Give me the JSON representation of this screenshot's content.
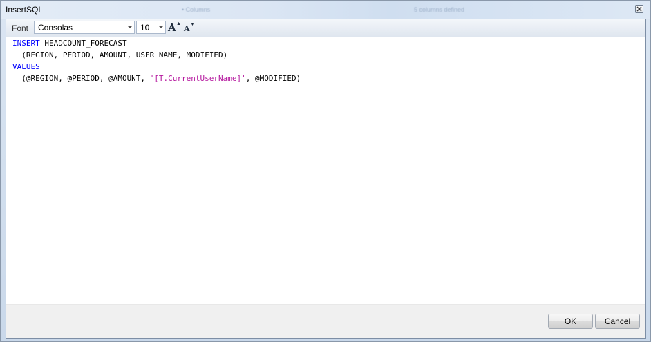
{
  "window": {
    "title": "InsertSQL",
    "background_hint_texts": [
      "• Columns",
      "5 columns defined"
    ]
  },
  "toolbar": {
    "font_label": "Font",
    "font_family_value": "Consolas",
    "font_size_value": "10",
    "grow_font_label": "A",
    "shrink_font_label": "A"
  },
  "editor": {
    "lines": [
      {
        "kw": "INSERT",
        "text": " HEADCOUNT_FORECAST"
      },
      {
        "text": "  (REGION, PERIOD, AMOUNT, USER_NAME, MODIFIED)"
      },
      {
        "kw": "VALUES"
      },
      {
        "pre": "  (@REGION, @PERIOD, @AMOUNT, ",
        "str": "'[T.CurrentUserName]'",
        "post": ", @MODIFIED)"
      }
    ]
  },
  "buttons": {
    "ok": "OK",
    "cancel": "Cancel"
  },
  "colors": {
    "keyword": "#0000ff",
    "string": "#b5179e",
    "window_frame": "#dbe6f4"
  }
}
